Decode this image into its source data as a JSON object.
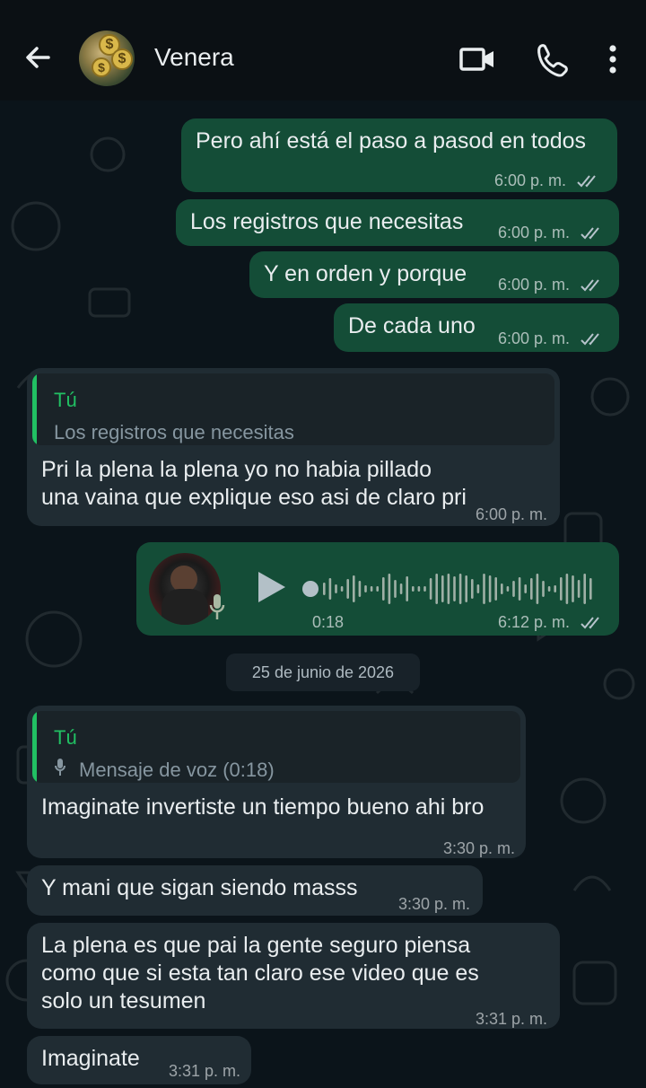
{
  "header": {
    "contact_name": "Venera",
    "icons": [
      "back-arrow-icon",
      "video-call-icon",
      "voice-call-icon",
      "more-options-icon"
    ]
  },
  "messages": [
    {
      "direction": "out",
      "text": "Pero ahí está el paso a pasod en todos",
      "time": "6:00 p. m.",
      "status": "read"
    },
    {
      "direction": "out",
      "text": "Los registros que necesitas",
      "time": "6:00 p. m.",
      "status": "read"
    },
    {
      "direction": "out",
      "text": "Y en orden y porque",
      "time": "6:00 p. m.",
      "status": "read"
    },
    {
      "direction": "out",
      "text": "De cada uno",
      "time": "6:00 p. m.",
      "status": "read"
    },
    {
      "direction": "in",
      "quote_author": "Tú",
      "quote_text": "Los registros que necesitas",
      "text": "Pri la plena la plena yo no habia pillado una vaina que explique eso asi de claro pri",
      "time": "6:00 p. m."
    },
    {
      "direction": "out",
      "type": "voice",
      "duration": "0:18",
      "time": "6:12 p. m.",
      "status": "read"
    },
    {
      "direction": "in",
      "quote_author": "Tú",
      "quote_text": "Mensaje de voz (0:18)",
      "text": "Imaginate invertiste un tiempo bueno ahi bro",
      "time": "3:30 p. m."
    },
    {
      "direction": "in",
      "text": "Y mani que sigan siendo masss",
      "time": "3:30 p. m."
    },
    {
      "direction": "in",
      "text": "La plena es que pai la gente seguro piensa como que si esta tan claro ese video que es solo un tesumen",
      "time": "3:31 p. m."
    },
    {
      "direction": "in",
      "text": "Imaginate",
      "time": "3:31 p. m."
    }
  ],
  "date_separator": "25 de junio de 2026",
  "colors": {
    "outgoing_bubble": "#144d37",
    "incoming_bubble": "#202c33",
    "accent_green": "#21c063",
    "read_ticks": "#b7c4cc"
  }
}
